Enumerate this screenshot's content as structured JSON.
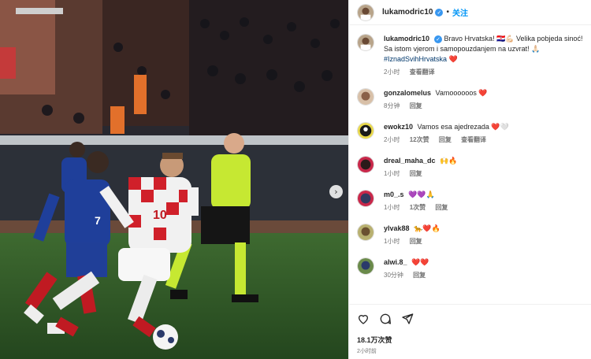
{
  "post": {
    "author": "lukamodric10",
    "follow_label": "关注",
    "separator": "•",
    "caption_text": "Bravo Hrvatska! 🇭🇷💪🏻 Velika pobjeda sinoć! Sa istom vjerom i samopouzdanjem na uzvrat! 🙏🏻",
    "caption_tag": "#IznadSvihHrvatska",
    "caption_emoji_end": "❤️",
    "caption_time": "2小时",
    "caption_translate": "查看翻译",
    "likes": "18.1万次赞",
    "posted_ago": "2小时前"
  },
  "comments": [
    {
      "user": "gonzalomelus",
      "text": "Vamoooooos ❤️",
      "time": "8分钟",
      "reply": "回复",
      "likes": "",
      "translate": ""
    },
    {
      "user": "ewokz10",
      "text": "Vamos esa ajedrezada ❤️🤍",
      "time": "2小时",
      "likes": "12次赞",
      "reply": "回复",
      "translate": "查看翻译"
    },
    {
      "user": "dreal_maha_dc",
      "text": "🙌🔥",
      "time": "1小时",
      "reply": "回复",
      "likes": "",
      "translate": ""
    },
    {
      "user": "m0_.s",
      "text": "💜💜🙏",
      "time": "1小时",
      "likes": "1次赞",
      "reply": "回复",
      "translate": ""
    },
    {
      "user": "ylvak88",
      "text": "🐆❤️🔥",
      "time": "1小时",
      "reply": "回复",
      "likes": "",
      "translate": ""
    },
    {
      "user": "alwi.8_",
      "text": "❤️❤️",
      "time": "30分钟",
      "reply": "回复",
      "likes": "",
      "translate": ""
    }
  ],
  "media": {
    "jersey_number": "10",
    "opponent_number": "7",
    "next_icon": "chevron-right-icon"
  },
  "colors": {
    "follow": "#0095f6",
    "verified": "#3897f0",
    "pitch": "#2f5a28",
    "france_kit": "#1f3f9a",
    "referee_kit": "#c6e832"
  }
}
